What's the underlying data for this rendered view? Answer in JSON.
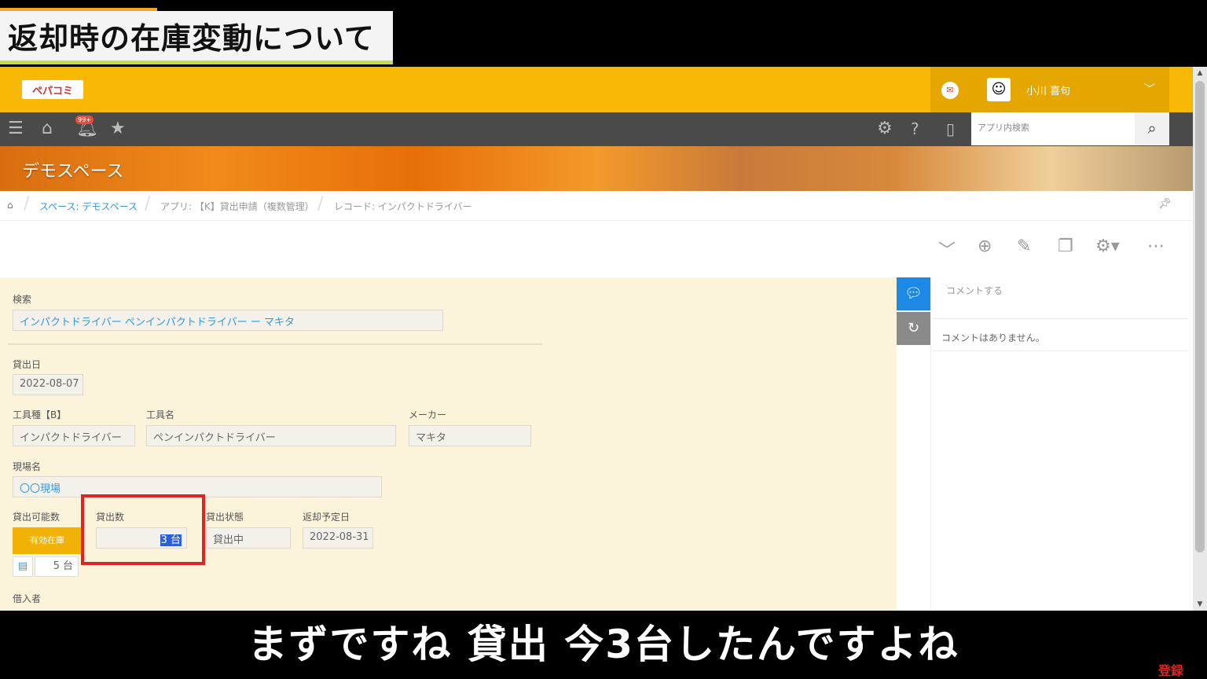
{
  "video": {
    "title": "返却時の在庫変動について",
    "subtitle": "まずですね 貸出 今3台したんですよね",
    "watermark": "登録"
  },
  "header": {
    "logo_text": "ペパコミ",
    "user_name": "小川 喜句"
  },
  "navbar": {
    "notification_badge": "99+",
    "search_placeholder": "アプリ内検索"
  },
  "space": {
    "name": "デモスペース"
  },
  "breadcrumb": {
    "space": "スペース: デモスペース",
    "app": "アプリ: 【K】貸出申請（複数管理）",
    "record": "レコード: インパクトドライバー"
  },
  "form": {
    "search_label": "検索",
    "search_value": "インパクトドライバー ペンインパクトドライバー ー マキタ",
    "lend_date_label": "貸出日",
    "lend_date_value": "2022-08-07",
    "tool_type_label": "工具種【B】",
    "tool_type_value": "インパクトドライバー",
    "tool_name_label": "工具名",
    "tool_name_value": "ペンインパクトドライバー",
    "maker_label": "メーカー",
    "maker_value": "マキタ",
    "site_label": "現場名",
    "site_value": "〇〇現場",
    "available_label": "貸出可能数",
    "available_button": "有効在庫",
    "available_value": "5 台",
    "quantity_label": "貸出数",
    "quantity_value": "3 台",
    "status_label": "貸出状態",
    "status_value": "貸出中",
    "return_label": "返却予定日",
    "return_value": "2022-08-31",
    "borrower_label": "借入者"
  },
  "comments": {
    "input_placeholder": "コメントする",
    "empty_text": "コメントはありません。"
  },
  "colors": {
    "header_yellow": "#f9b706",
    "nav_dark": "#4a4a4a",
    "form_bg": "#fcf3db",
    "highlight_red": "#e02424",
    "comment_tab_blue": "#1e88e5"
  }
}
